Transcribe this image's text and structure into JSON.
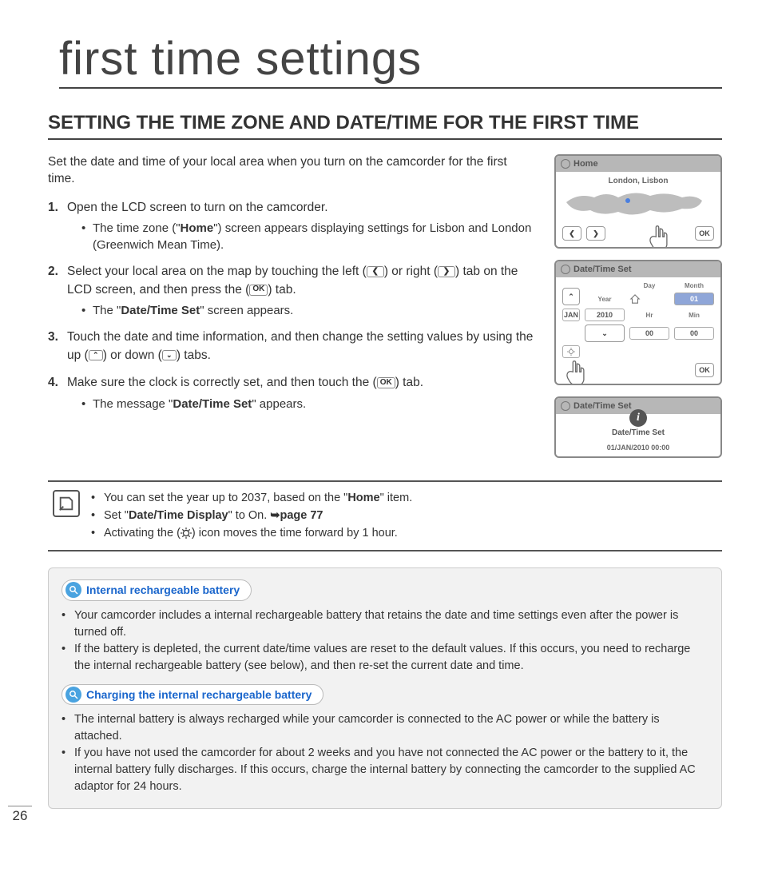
{
  "page_title": "first time settings",
  "section_title": "SETTING THE TIME ZONE AND DATE/TIME FOR THE FIRST TIME",
  "intro": "Set the date and time of your local area when you turn on the camcorder for the first time.",
  "steps": {
    "s1": {
      "num": "1.",
      "text": "Open the LCD screen to turn on the camcorder.",
      "sub1a": "The time zone (\"",
      "sub1b": "Home",
      "sub1c": "\") screen appears displaying settings for Lisbon and London (Greenwich Mean Time)."
    },
    "s2": {
      "num": "2.",
      "text_a": "Select your local area on the map by touching the left (",
      "text_b": ") or right (",
      "text_c": ") tab on the LCD screen, and then press the (",
      "text_d": ") tab.",
      "sub_a": "The \"",
      "sub_b": "Date/Time Set",
      "sub_c": "\" screen appears."
    },
    "s3": {
      "num": "3.",
      "text_a": "Touch the date and time information, and then change the setting values by using the up (",
      "text_b": ") or down (",
      "text_c": ") tabs."
    },
    "s4": {
      "num": "4.",
      "text_a": "Make sure the clock is correctly set, and then touch the (",
      "text_b": ") tab.",
      "sub_a": "The message \"",
      "sub_b": "Date/Time Set",
      "sub_c": "\" appears."
    }
  },
  "btn": {
    "left": "❮",
    "right": "❯",
    "up": "⌃",
    "down": "⌄",
    "ok": "OK"
  },
  "screens": {
    "home": {
      "title": "Home",
      "city": "London, Lisbon",
      "ok": "OK"
    },
    "dt": {
      "title": "Date/Time Set",
      "labels": {
        "day": "Day",
        "month": "Month",
        "year": "Year",
        "hr": "Hr",
        "min": "Min"
      },
      "vals": {
        "day": "01",
        "month": "JAN",
        "year": "2010",
        "hr": "00",
        "min": "00"
      },
      "ok": "OK"
    },
    "confirm": {
      "title": "Date/Time Set",
      "msg": "Date/Time Set",
      "stamp": "01/JAN/2010 00:00"
    }
  },
  "notes": {
    "n1a": "You can set the year up to 2037, based on the \"",
    "n1b": "Home",
    "n1c": "\" item.",
    "n2a": "Set \"",
    "n2b": "Date/Time Display",
    "n2c": "\" to On. ",
    "n2ref": "➥page 77",
    "n3a": "Activating the (",
    "n3b": ") icon moves the time forward by 1 hour."
  },
  "panel": {
    "h1": "Internal rechargeable battery",
    "p1": "Your camcorder includes a internal rechargeable battery that retains the date and time settings even after the power is turned off.",
    "p2": "If the battery is depleted, the current date/time values are reset to the default values. If this occurs, you need to recharge the internal rechargeable battery (see below), and then re-set the current date and time.",
    "h2": "Charging the internal rechargeable battery",
    "p3": "The internal battery is always recharged while your camcorder is connected to the AC power or while the battery is attached.",
    "p4": "If you have not used the camcorder for about 2 weeks and you have not connected the AC power or the battery to it, the internal battery fully discharges. If this occurs, charge the internal battery by connecting the camcorder to the supplied AC adaptor for 24 hours."
  },
  "page_number": "26"
}
